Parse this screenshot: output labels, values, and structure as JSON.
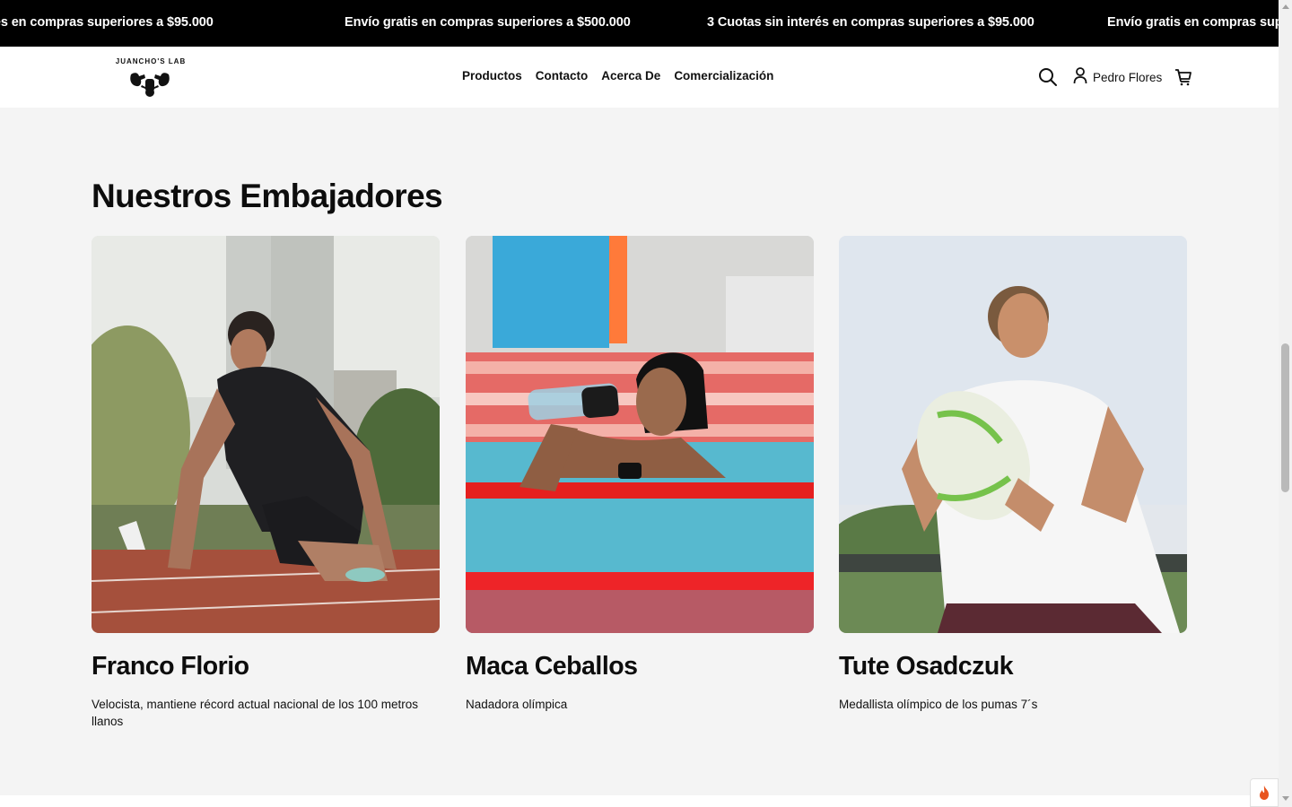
{
  "announcement_bar": {
    "items": [
      "3 Cuotas sin interés en compras superiores a $95.000",
      "Envío gratis en compras superiores a $500.000",
      "3 Cuotas sin interés en compras superiores a $95.000",
      "Envío gratis en compras superiores a $500.000"
    ]
  },
  "header": {
    "logo_text": "JUANCHO'S LAB",
    "nav": [
      "Productos",
      "Contacto",
      "Acerca De",
      "Comercialización"
    ],
    "account_name": "Pedro Flores",
    "icons": [
      "search-icon",
      "user-icon",
      "cart-icon"
    ]
  },
  "section": {
    "title": "Nuestros Embajadores",
    "ambassadors": [
      {
        "name": "Franco Florio",
        "description": "Velocista, mantiene récord actual nacional de los 100 metros llanos"
      },
      {
        "name": "Maca Ceballos",
        "description": "Nadadora olímpica"
      },
      {
        "name": "Tute Osadczuk",
        "description": "Medallista olímpico de los pumas 7´s"
      }
    ]
  },
  "colors": {
    "announcement_bg": "#000000",
    "page_bg": "#f4f4f4",
    "text": "#111111"
  }
}
